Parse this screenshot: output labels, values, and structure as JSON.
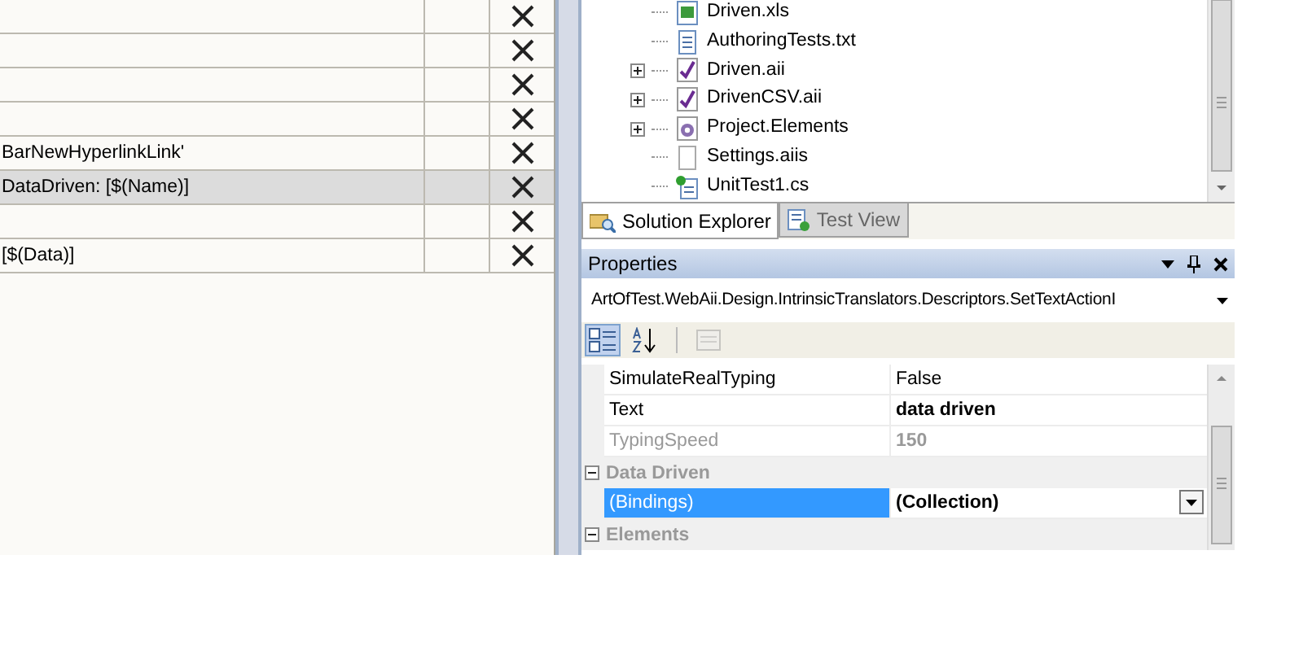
{
  "grid": {
    "rows": [
      {
        "text": "",
        "selected": false
      },
      {
        "text": "",
        "selected": false
      },
      {
        "text": "",
        "selected": false
      },
      {
        "text": "",
        "selected": false
      },
      {
        "text": "BarNewHyperlinkLink'",
        "selected": false
      },
      {
        "text": "DataDriven: [$(Name)]",
        "selected": true
      },
      {
        "text": "",
        "selected": false
      },
      {
        "text": "[$(Data)]",
        "selected": false
      }
    ]
  },
  "solution_explorer": {
    "items": [
      {
        "label": "Driven.xls",
        "kind": "excel"
      },
      {
        "label": "AuthoringTests.txt",
        "kind": "text"
      },
      {
        "label": "Driven.aii",
        "kind": "test",
        "expanded": false
      },
      {
        "label": "DrivenCSV.aii",
        "kind": "test",
        "expanded": false
      },
      {
        "label": "Project.Elements",
        "kind": "elements",
        "expanded": false
      },
      {
        "label": "Settings.aiis",
        "kind": "blank"
      },
      {
        "label": "UnitTest1.cs",
        "kind": "csharp"
      }
    ]
  },
  "tabs": [
    {
      "label": "Solution Explorer",
      "selected": true
    },
    {
      "label": "Test View",
      "selected": false
    }
  ],
  "properties": {
    "title": "Properties",
    "object": "ArtOfTest.WebAii.Design.IntrinsicTranslators.Descriptors.SetTextActionI",
    "toolbar": [
      {
        "kind": "categorized",
        "selected": true,
        "disabled": false
      },
      {
        "kind": "alphabetical",
        "selected": false,
        "disabled": false
      },
      {
        "kind": "pages",
        "selected": false,
        "disabled": true
      }
    ],
    "rows": [
      {
        "kind": "property",
        "name": "SimulateRealTyping",
        "value": "False",
        "modified": false,
        "disabled": false,
        "selected": false,
        "dropdown": false
      },
      {
        "kind": "property",
        "name": "Text",
        "value": "data driven",
        "modified": true,
        "disabled": false,
        "selected": false,
        "dropdown": false
      },
      {
        "kind": "property",
        "name": "TypingSpeed",
        "value": "150",
        "modified": true,
        "disabled": true,
        "selected": false,
        "dropdown": false
      },
      {
        "kind": "category",
        "name": "Data Driven",
        "expanded": true
      },
      {
        "kind": "property",
        "name": "(Bindings)",
        "value": "(Collection)",
        "modified": true,
        "disabled": false,
        "selected": true,
        "dropdown": true
      },
      {
        "kind": "category",
        "name": "Elements",
        "expanded": true
      }
    ]
  }
}
